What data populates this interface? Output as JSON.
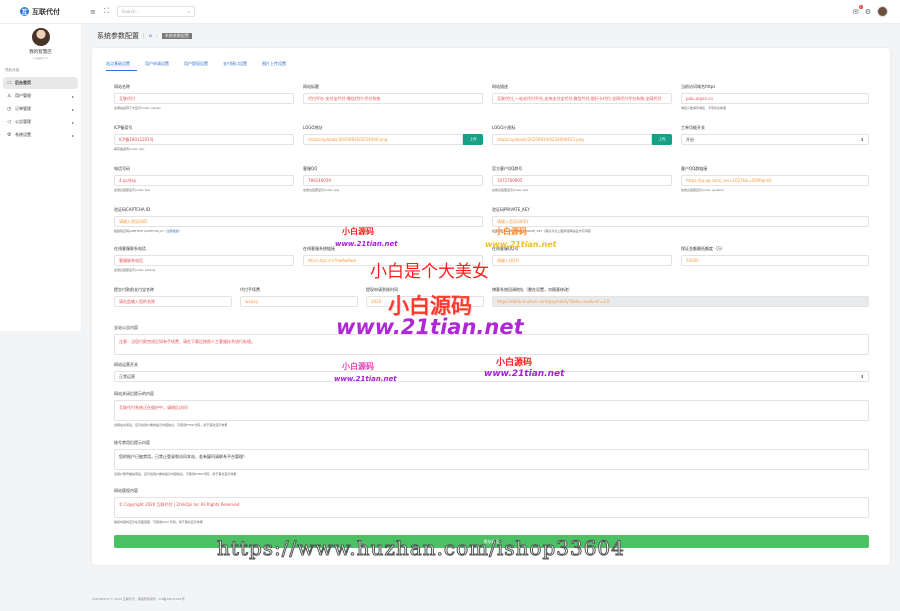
{
  "app": {
    "logo_text": "互联代付",
    "logo_mark": "互"
  },
  "topbar": {
    "search_placeholder": "Search...",
    "notif_count": "1"
  },
  "sidebar": {
    "user_name": "我的智慧店",
    "user_status": "Logged in",
    "nav_header": "导航分组",
    "items": [
      {
        "label": "后台首页",
        "icon": "monitor-icon",
        "glyph": "▭"
      },
      {
        "label": "用户管理",
        "icon": "user-icon",
        "glyph": "♙"
      },
      {
        "label": "订单管理",
        "icon": "clock-icon",
        "glyph": "◷"
      },
      {
        "label": "公告管理",
        "icon": "megaphone-icon",
        "glyph": "◁"
      },
      {
        "label": "系统设置",
        "icon": "gear-icon",
        "glyph": "⚙"
      }
    ]
  },
  "breadcrumb": {
    "title": "系统参数配置",
    "current": "系统参数配置"
  },
  "tabs": [
    "站点基础设置",
    "用户申请设置",
    "用户提现设置",
    "支付接口设置",
    "图片上传设置"
  ],
  "form": {
    "site_name": {
      "label": "网站名称",
      "value": "互联代付",
      "help": "在网站名称下方显示(note: name)"
    },
    "site_title": {
      "label": "网站标题",
      "value": "代付平台-支付宝代付-微信代付-代付系统",
      "help": ""
    },
    "site_desc": {
      "label": "网站描述",
      "value": "互联代付_一站式代付平台,支持支付宝代付,微信代付,银行卡代付,全网代付平台系统,全网代付",
      "help": ""
    },
    "site_domain": {
      "label": "当前访问域名https",
      "value": "paiu.aipon.cn",
      "help": "域名只能填写域名，不带协议前缀"
    },
    "icp": {
      "label": "ICP备案号",
      "value": "ICP备18011201号",
      "help": "填写备案号(note: icp)"
    },
    "logo": {
      "label": "LOGO地址",
      "value": "/static/uploads/20200810/0254000.png",
      "button": "上传"
    },
    "logo_small": {
      "label": "LOGO小图标",
      "value": "/static/uploads/20200810/0254000413.png",
      "button": "上传"
    },
    "work_status": {
      "label": "工单功能开关",
      "value": "开启"
    },
    "contact_phone": {
      "label": "电话号码",
      "value": "4 pc/day",
      "help": "在前台底部显示(note: tel)"
    },
    "qq": {
      "label": "客服QQ",
      "value": "789146059",
      "help": "在前台底部显示(note: qq)"
    },
    "wechat": {
      "label": "官方客户QQ群号",
      "value": "1072769905",
      "help": "在前台底部显示(note: wx)"
    },
    "qq_link": {
      "label": "客户QQ群链接",
      "value": "https://jq.qq.com/_wv=1027&k=5OMlqnVk",
      "help": "在前台底部显示(note: qunlink)"
    },
    "captcha_mode": {
      "label": "验证码CAPTCHA ID",
      "value": "请输入验证码ID",
      "help": "极验验证码(GEETEST)CAPTCHA_ID（",
      "link": "注册极验",
      "help_tail": "）"
    },
    "captcha_key": {
      "label": "验证码PRIVATE_KEY",
      "value": "请输入验证码KEY",
      "help": "极验验证码(GEETEST)PRIVATE_KEY（需在平台上面添加网站后方可获取）"
    },
    "service_tel": {
      "label": "在线客服联系电话",
      "value": "客服联系电话",
      "help": "在前台底部显示(note: phone)"
    },
    "service_link": {
      "label": "在线客服系统链接",
      "value": "dkv.h.tzjs.cn/?hwAwAwa",
      "help": ""
    },
    "service_qq": {
      "label": "在线客服QQ号",
      "value": "请输入QQ号",
      "help": ""
    },
    "min_withdraw": {
      "label": "保证金额最低额度（万）",
      "value": "10000",
      "help": ""
    },
    "alipay_name": {
      "label": "提交付款前支付宝名称",
      "value": "请在此输入您的名称",
      "help": ""
    },
    "alipay_fee": {
      "label": "代付手续费",
      "value": "wxpay",
      "help": ""
    },
    "alipay_time": {
      "label": "提现申请到账时间",
      "value": "2020",
      "help": ""
    },
    "copyright_link": {
      "label": "博客系统回调地址（需在设置，勿随意修改）",
      "value": "https://daifu.huzhan.com/pay/notify?data=xxx&ver=2.0",
      "help": ""
    },
    "notice": {
      "label": "全站公告内容",
      "value": "注意：当您付款完成后如有手续费，请在下载后按照人工客服技术进行处理。"
    },
    "maintenance": {
      "label": "网站运营开关",
      "value": "正常运营"
    },
    "close_reason": {
      "label": "网站关闭后提示的内容",
      "value": "互联代付系统正在维护中，请稍后访问！",
      "help": "当网站关闭后，显示给用户看的提示内容信息，可使用HTML代码，用于美化显示效果"
    },
    "ban_reason": {
      "label": "账号禁用后提示内容",
      "value": "您的账户已被禁用，已禁止登录和访问本站，若有疑问请联系平台管理！",
      "help": "当用户账号被禁用后，显示给用户看的提示内容信息，可使用HTML代码，用于美化显示效果"
    },
    "copyright": {
      "label": "网站版权内容",
      "value": "© Copyright 2020 互联代付 | ZmkOpi Inc All Rights Reserved",
      "help": "版权内容将显示在页面底部，可使用html 代码，用于美化显示效果"
    },
    "save_label": "保存修改"
  },
  "watermarks": {
    "brand_1": "小白源码",
    "url_1": "www.21tian.net",
    "brand_big": "小白是个大美女",
    "brand_logo": "小白源码",
    "url_big": "www.21tian.net",
    "brand_2": "小白源码",
    "url_2": "www.21tian.net",
    "brand_3": "小白源码",
    "url_3": "www.21tian.net",
    "brand_4": "小白源码",
    "url_4": "www.21tian.net",
    "url_huzhan": "https://www.huzhan.com/ishop33604"
  },
  "footer": {
    "text": "COPYRIGHT © 2020 互联代付 · 保留所有权利 · ICP备18011201号"
  }
}
